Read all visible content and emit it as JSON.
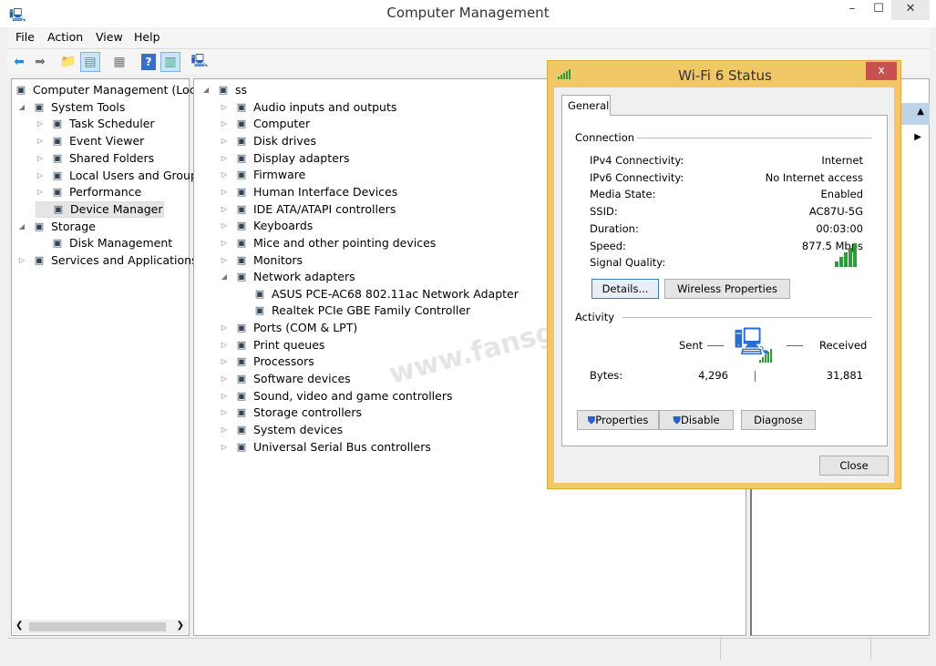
{
  "window": {
    "title": "Computer Management",
    "minimize": "–",
    "maximize": "☐",
    "close": "✕"
  },
  "menu": [
    "File",
    "Action",
    "View",
    "Help"
  ],
  "tree": [
    {
      "label": "Computer Management (Local",
      "level": 0,
      "expander": "",
      "icon": "computer-management-icon"
    },
    {
      "label": "System Tools",
      "level": 1,
      "expander": "◢",
      "icon": "tools-icon"
    },
    {
      "label": "Task Scheduler",
      "level": 2,
      "expander": "▷",
      "icon": "clock-icon"
    },
    {
      "label": "Event Viewer",
      "level": 2,
      "expander": "▷",
      "icon": "event-viewer-icon"
    },
    {
      "label": "Shared Folders",
      "level": 2,
      "expander": "▷",
      "icon": "shared-folder-icon"
    },
    {
      "label": "Local Users and Groups",
      "level": 2,
      "expander": "▷",
      "icon": "users-icon"
    },
    {
      "label": "Performance",
      "level": 2,
      "expander": "▷",
      "icon": "performance-icon"
    },
    {
      "label": "Device Manager",
      "level": 2,
      "expander": "",
      "icon": "device-manager-icon",
      "selected": true
    },
    {
      "label": "Storage",
      "level": 1,
      "expander": "◢",
      "icon": "storage-icon"
    },
    {
      "label": "Disk Management",
      "level": 2,
      "expander": "",
      "icon": "disk-icon"
    },
    {
      "label": "Services and Applications",
      "level": 1,
      "expander": "▷",
      "icon": "services-icon"
    }
  ],
  "devices": [
    {
      "label": "ss",
      "level": 0,
      "expander": "◢"
    },
    {
      "label": "Audio inputs and outputs",
      "level": 1,
      "expander": "▷"
    },
    {
      "label": "Computer",
      "level": 1,
      "expander": "▷"
    },
    {
      "label": "Disk drives",
      "level": 1,
      "expander": "▷"
    },
    {
      "label": "Display adapters",
      "level": 1,
      "expander": "▷"
    },
    {
      "label": "Firmware",
      "level": 1,
      "expander": "▷"
    },
    {
      "label": "Human Interface Devices",
      "level": 1,
      "expander": "▷"
    },
    {
      "label": "IDE ATA/ATAPI controllers",
      "level": 1,
      "expander": "▷"
    },
    {
      "label": "Keyboards",
      "level": 1,
      "expander": "▷"
    },
    {
      "label": "Mice and other pointing devices",
      "level": 1,
      "expander": "▷"
    },
    {
      "label": "Monitors",
      "level": 1,
      "expander": "▷"
    },
    {
      "label": "Network adapters",
      "level": 1,
      "expander": "◢"
    },
    {
      "label": "ASUS PCE-AC68 802.11ac Network Adapter",
      "level": 2,
      "expander": ""
    },
    {
      "label": "Realtek PCIe GBE Family Controller",
      "level": 2,
      "expander": ""
    },
    {
      "label": "Ports (COM & LPT)",
      "level": 1,
      "expander": "▷"
    },
    {
      "label": "Print queues",
      "level": 1,
      "expander": "▷"
    },
    {
      "label": "Processors",
      "level": 1,
      "expander": "▷"
    },
    {
      "label": "Software devices",
      "level": 1,
      "expander": "▷"
    },
    {
      "label": "Sound, video and game controllers",
      "level": 1,
      "expander": "▷"
    },
    {
      "label": "Storage controllers",
      "level": 1,
      "expander": "▷"
    },
    {
      "label": "System devices",
      "level": 1,
      "expander": "▷"
    },
    {
      "label": "Universal Serial Bus controllers",
      "level": 1,
      "expander": "▷"
    }
  ],
  "dialog": {
    "title": "Wi-Fi 6 Status",
    "close": "x",
    "tab": "General",
    "connection": {
      "heading": "Connection",
      "rows": [
        {
          "label": "IPv4 Connectivity:",
          "value": "Internet"
        },
        {
          "label": "IPv6 Connectivity:",
          "value": "No Internet access"
        },
        {
          "label": "Media State:",
          "value": "Enabled"
        },
        {
          "label": "SSID:",
          "value": "AC87U-5G"
        },
        {
          "label": "Duration:",
          "value": "00:03:00"
        },
        {
          "label": "Speed:",
          "value": "877.5 Mbps"
        }
      ],
      "signal_label": "Signal Quality:",
      "signal_bars": 5,
      "signal_max": 5
    },
    "details_button": "Details...",
    "wireless_button": "Wireless Properties",
    "activity": {
      "heading": "Activity",
      "sent": "Sent",
      "received": "Received",
      "bytes_label": "Bytes:",
      "bytes_sent": "4,296",
      "bytes_received": "31,881"
    },
    "properties_button": "Properties",
    "disable_button": "Disable",
    "diagnose_button": "Diagnose",
    "close_button": "Close"
  },
  "watermark": "www.fansgu.com",
  "colors": {
    "dialog_border": "#f2c765",
    "close_red": "#c75050",
    "signal_green": "#2f9a3a",
    "selection": "#cce4f7"
  }
}
